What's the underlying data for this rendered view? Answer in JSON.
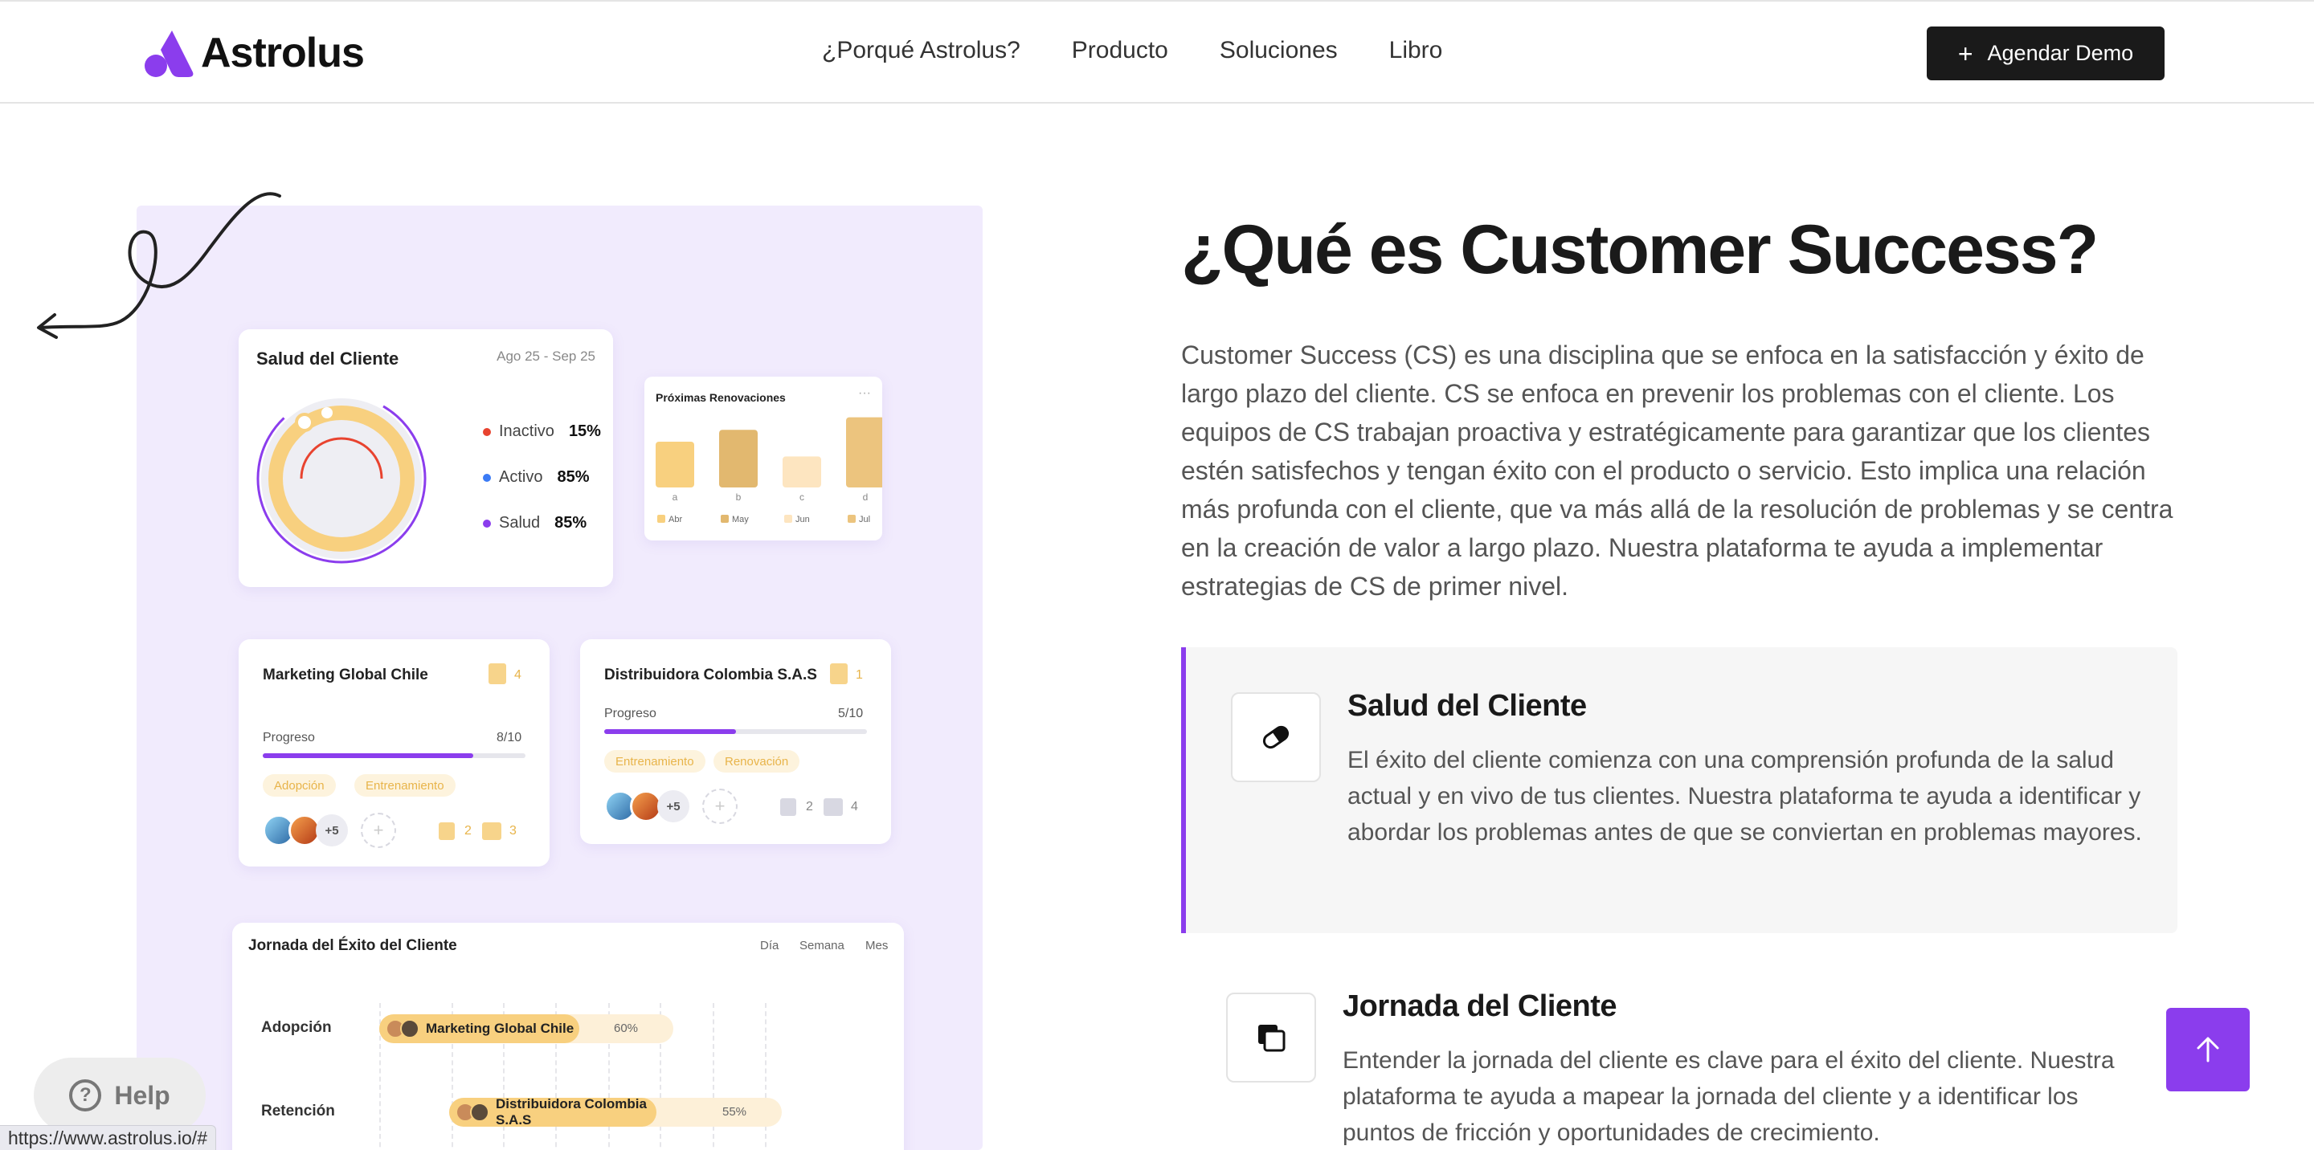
{
  "header": {
    "logo_text": "Astrolus",
    "nav": [
      "¿Porqué Astrolus?",
      "Producto",
      "Soluciones",
      "Libro"
    ],
    "demo_button": "Agendar Demo"
  },
  "colors": {
    "accent": "#8b3ded",
    "dark": "#1a1a1a",
    "lavender": "#f1ebfd",
    "gold": "#f8d07f"
  },
  "visual": {
    "health": {
      "title": "Salud del Cliente",
      "dates": "Ago 25 - Sep 25",
      "legend": [
        {
          "label": "Inactivo",
          "value": "15%",
          "color": "#e8432f"
        },
        {
          "label": "Activo",
          "value": "85%",
          "color": "#3b7bf5"
        },
        {
          "label": "Salud",
          "value": "85%",
          "color": "#8b3ded"
        }
      ]
    },
    "renewals": {
      "title": "Próximas Renovaciones",
      "dots": "···",
      "categories": [
        "a",
        "b",
        "c",
        "d"
      ],
      "values": [
        0.62,
        0.78,
        0.42,
        0.95
      ],
      "legend": [
        "Abr",
        "May",
        "Jun",
        "Jul"
      ],
      "bar_colors": [
        "#f8d07f",
        "#e2b86f",
        "#fde5c0",
        "#ecc47e"
      ]
    },
    "projects": [
      {
        "name": "Marketing Global Chile",
        "docs": "4",
        "progress_label": "Progreso",
        "progress": "8/10",
        "progress_value": 0.8,
        "tags": [
          "Adopción",
          "Entrenamiento"
        ],
        "more": "+5",
        "files": "2",
        "comments": "3"
      },
      {
        "name": "Distribuidora Colombia S.A.S",
        "docs": "1",
        "progress_label": "Progreso",
        "progress": "5/10",
        "progress_value": 0.5,
        "tags": [
          "Entrenamiento",
          "Renovación"
        ],
        "more": "+5",
        "files": "2",
        "comments": "4"
      }
    ],
    "journey": {
      "title": "Jornada del Éxito del Cliente",
      "tabs": [
        "Día",
        "Semana",
        "Mes"
      ],
      "rows": [
        {
          "stage": "Adopción",
          "client": "Marketing Global Chile",
          "percent": "60%",
          "progress": 0.6
        },
        {
          "stage": "Retención",
          "client": "Distribuidora Colombia S.A.S",
          "percent": "55%",
          "progress": 0.55
        }
      ]
    }
  },
  "content": {
    "heading": "¿Qué es Customer Success?",
    "intro": "Customer Success (CS) es una disciplina que se enfoca en la satisfacción y éxito de largo plazo del cliente. CS se enfoca en prevenir los problemas con el cliente. Los equipos de CS trabajan proactiva y estratégicamente para garantizar que los clientes estén satisfechos y tengan éxito con el producto o servicio. Esto implica una relación más profunda con el cliente, que va más allá de la resolución de problemas y se centra en la creación de valor a largo plazo. Nuestra plataforma te ayuda a implementar estrategias de CS de primer nivel.",
    "features": [
      {
        "title": "Salud del Cliente",
        "icon": "pill-icon",
        "description": "El éxito del cliente comienza con una comprensión profunda de la salud actual y en vivo de tus clientes. Nuestra plataforma te ayuda a identificar y abordar los problemas antes de que se conviertan en problemas mayores."
      },
      {
        "title": "Jornada del Cliente",
        "icon": "layers-icon",
        "description": "Entender la jornada del cliente es clave para el éxito del cliente. Nuestra plataforma te ayuda a mapear la jornada del cliente y a identificar los puntos de fricción y oportunidades de crecimiento."
      }
    ]
  },
  "help_label": "Help",
  "status_url": "https://www.astrolus.io/#"
}
